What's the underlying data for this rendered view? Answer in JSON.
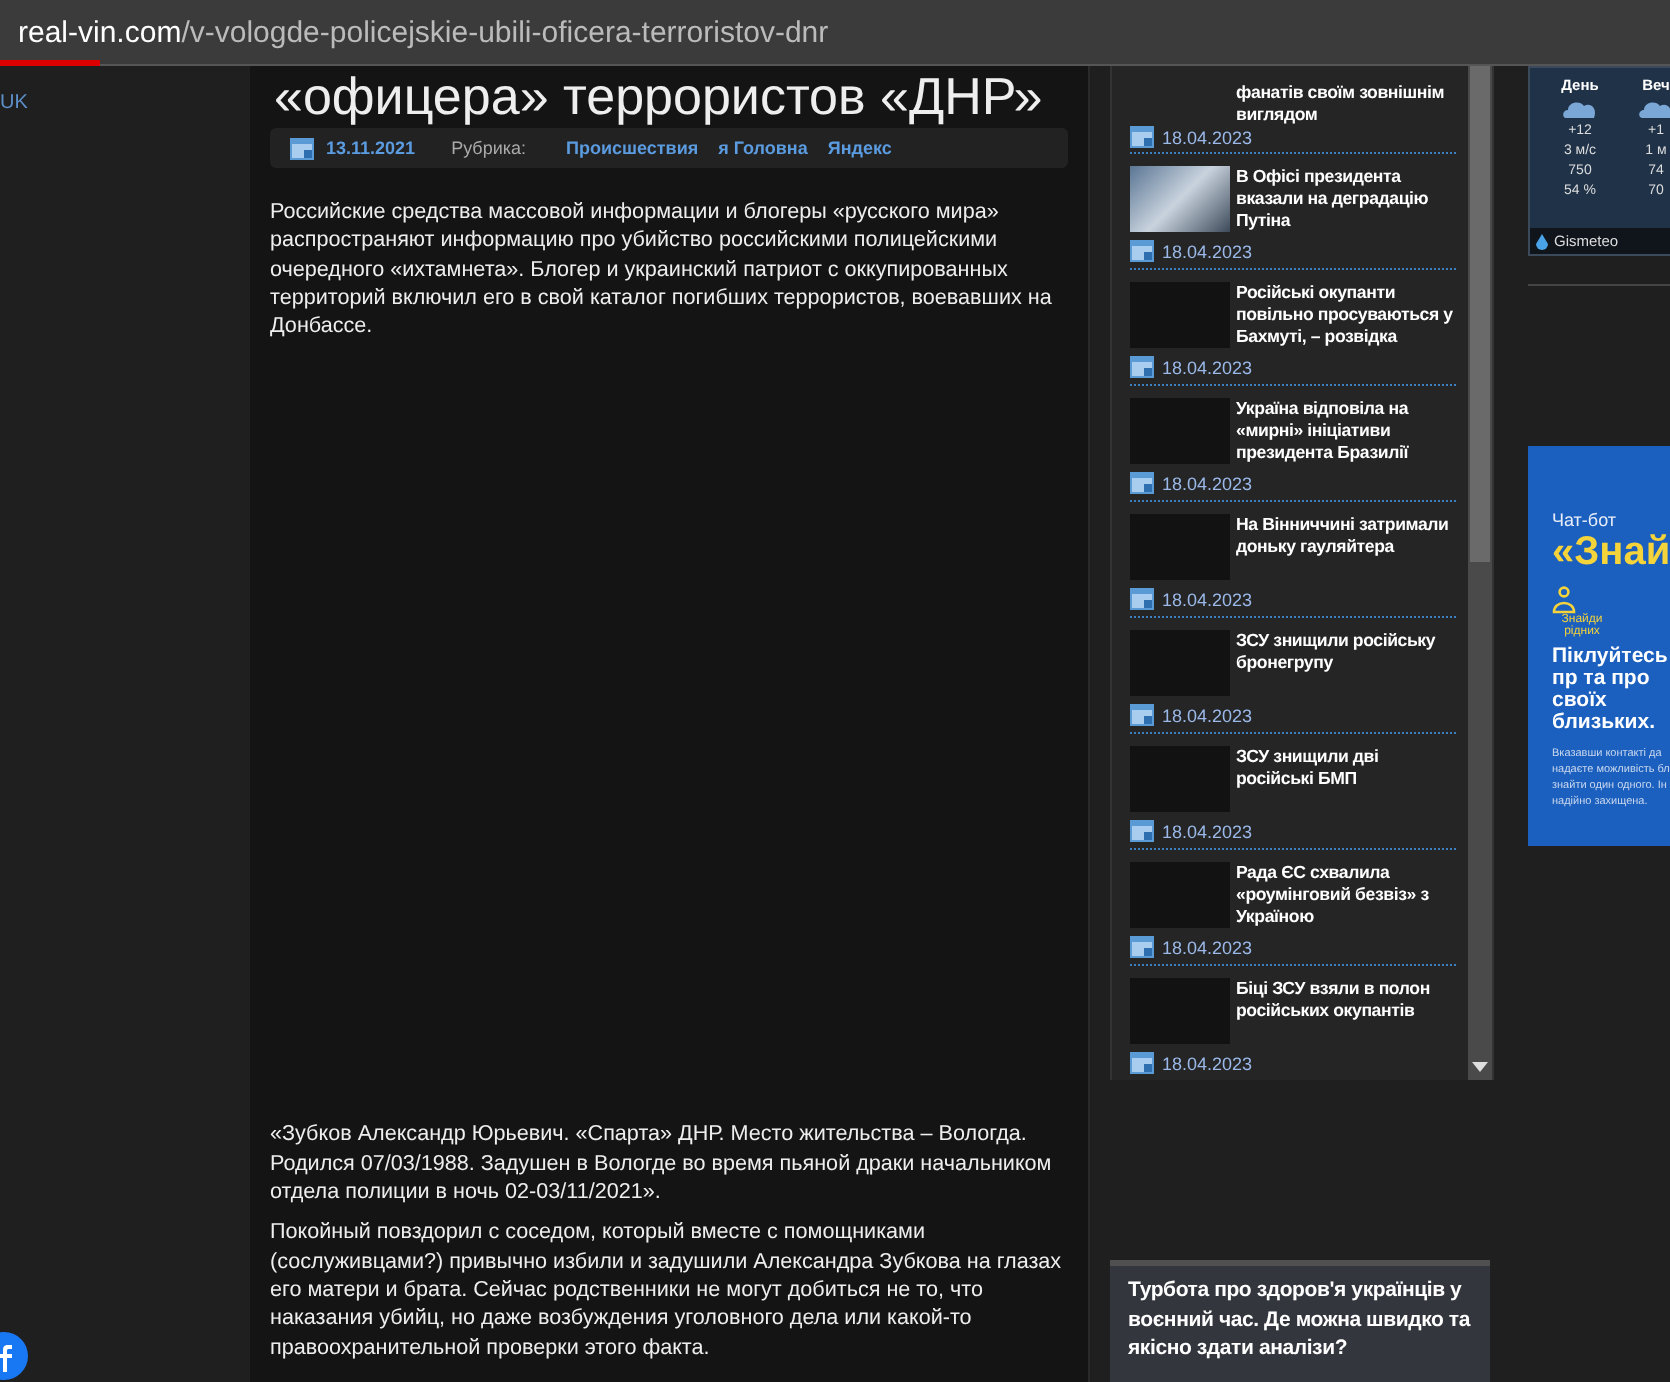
{
  "address_bar": {
    "domain": "real-vin.com",
    "path": "/v-vologde-policejskie-ubili-oficera-terroristov-dnr"
  },
  "sidebar": {
    "language_link": "UK"
  },
  "article": {
    "title": "«офицера» террористов «ДНР»",
    "date": "13.11.2021",
    "rubric_label": "Рубрика:",
    "rubrics": [
      "Происшествия",
      "я Головна",
      "Яндекс"
    ],
    "intro": "Российские средства массовой информации и блогеры «русского мира» распространяют информацию про убийство российскими полицейскими очередного «ихтамнета». Блогер и украинский патриот с оккупированных территорий включил его в свой каталог погибших террористов, воевавших на Донбассе.",
    "paragraphs": [
      "«Зубков Александр Юрьевич. «Спарта» ДНР. Место жительства – Вологда. Родился 07/03/1988. Задушен в Вологде во время пьяной драки начальником отдела полиции в ночь 02-03/11/2021».",
      "Покойный повздорил с соседом, который вместе с помощниками (сослуживцами?) привычно избили и задушили Александра Зубкова на глазах его матери и брата. Сейчас родственники не могут добиться не то, что наказания убийц, но даже возбуждения уголовного дела или какой-то правоохранительной проверки этого факта."
    ]
  },
  "news_feed": {
    "items": [
      {
        "title": "фанатів своїм зовнішнім виглядом",
        "date": "18.04.2023",
        "kind": "cut"
      },
      {
        "title": "В Офісі президента вказали на деградацію Путіна",
        "date": "18.04.2023",
        "kind": "photo"
      },
      {
        "title": "Російські окупанти повільно просуваються у Бахмуті, – розвідка",
        "date": "18.04.2023",
        "kind": "blank"
      },
      {
        "title": "Україна відповіла на «мирні» ініціативи президента Бразилії",
        "date": "18.04.2023",
        "kind": "blank"
      },
      {
        "title": "На Вінниччині затримали доньку гауляйтера",
        "date": "18.04.2023",
        "kind": "blank"
      },
      {
        "title": "ЗСУ знищили російську бронегрупу",
        "date": "18.04.2023",
        "kind": "blank"
      },
      {
        "title": "ЗСУ знищили дві російські БМП",
        "date": "18.04.2023",
        "kind": "blank"
      },
      {
        "title": "Рада ЄС схвалила «роумінговий безвіз» з Україною",
        "date": "18.04.2023",
        "kind": "blank"
      },
      {
        "title": "Біці ЗСУ взяли в полон російських окупантів",
        "date": "18.04.2023",
        "kind": "blank"
      }
    ]
  },
  "weather": {
    "columns": [
      {
        "label": "День",
        "values": [
          "+12",
          "3 м/с",
          "750",
          "54 %"
        ]
      },
      {
        "label": "Веч",
        "values": [
          "+1",
          "1 м",
          "74",
          "70"
        ]
      }
    ],
    "brand": "Gismeteo"
  },
  "ad": {
    "kicker": "Чат-бот",
    "headline": "«Знай",
    "logo_caption": "Знайди рідних",
    "title": "Піклуйтесь пр та про своїх близьких.",
    "body": "Вказавши контакті да надаєте можливість бл знайти один одного. Ін надійно захищена."
  },
  "promo_card": {
    "title": "Турбота про здоров'я українців у воєнний час. Де можна швидко та якісно здати аналізи?"
  }
}
